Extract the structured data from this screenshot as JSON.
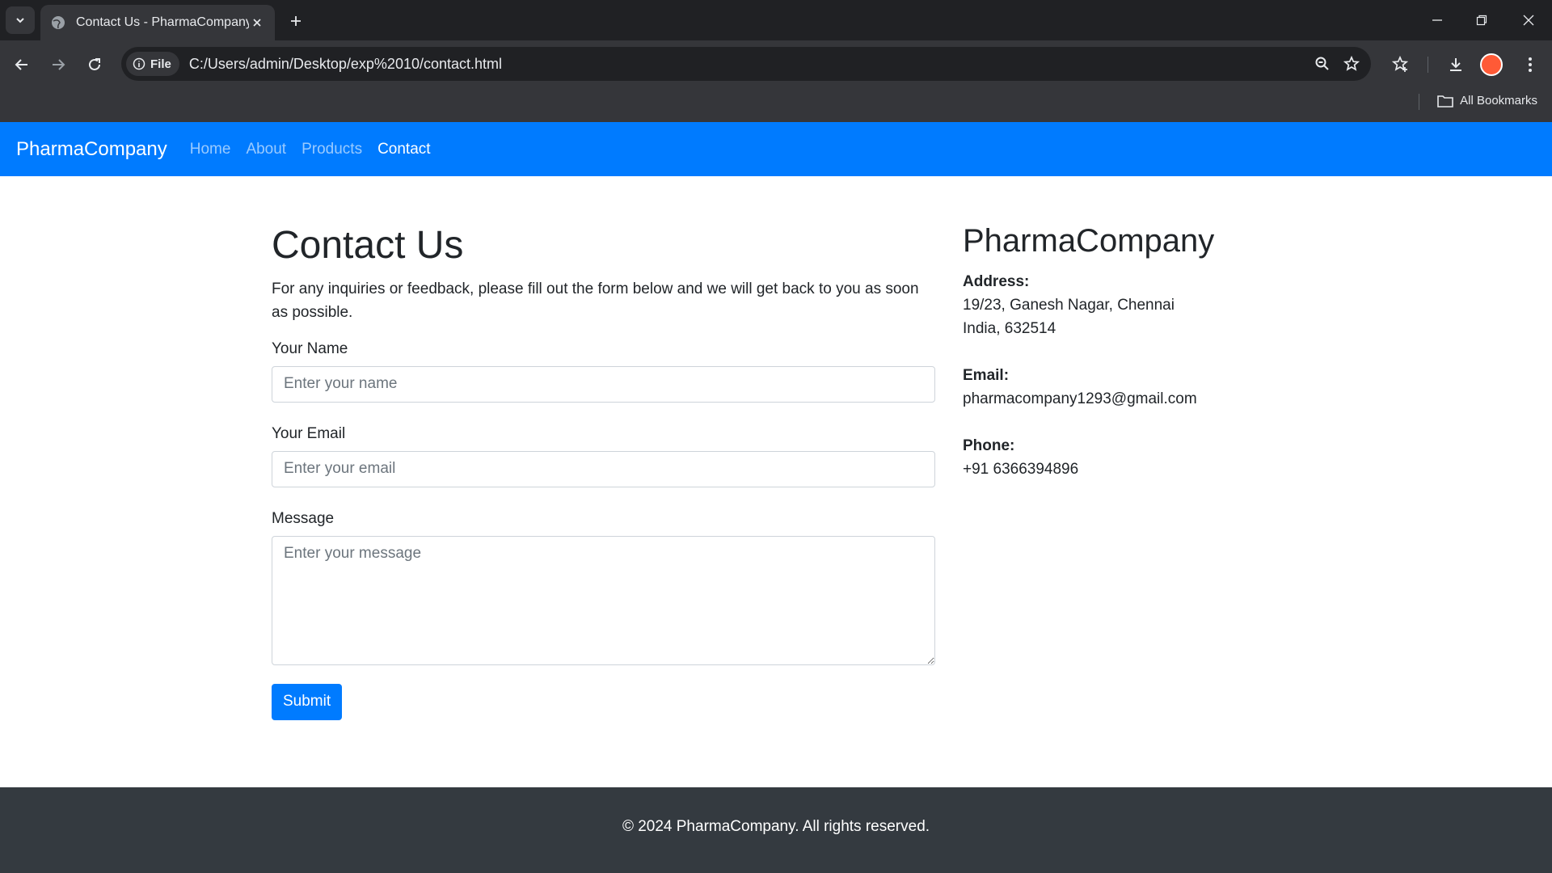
{
  "browser": {
    "tab_title": "Contact Us - PharmaCompany",
    "chip_label": "File",
    "url": "C:/Users/admin/Desktop/exp%2010/contact.html",
    "bookmarks_label": "All Bookmarks"
  },
  "navbar": {
    "brand": "PharmaCompany",
    "links": [
      {
        "label": "Home",
        "active": false
      },
      {
        "label": "About",
        "active": false
      },
      {
        "label": "Products",
        "active": false
      },
      {
        "label": "Contact",
        "active": true
      }
    ],
    "accent_color": "#007bff"
  },
  "contact": {
    "title": "Contact Us",
    "intro": "For any inquiries or feedback, please fill out the form below and we will get back to you as soon as possible.",
    "fields": {
      "name_label": "Your Name",
      "name_placeholder": "Enter your name",
      "email_label": "Your Email",
      "email_placeholder": "Enter your email",
      "message_label": "Message",
      "message_placeholder": "Enter your message"
    },
    "submit_label": "Submit"
  },
  "company": {
    "name": "PharmaCompany",
    "address_label": "Address:",
    "address_line1": "19/23, Ganesh Nagar, Chennai",
    "address_line2": "India, 632514",
    "email_label": "Email:",
    "email": "pharmacompany1293@gmail.com",
    "phone_label": "Phone:",
    "phone": "+91 6366394896"
  },
  "footer": {
    "text": "© 2024 PharmaCompany. All rights reserved."
  }
}
